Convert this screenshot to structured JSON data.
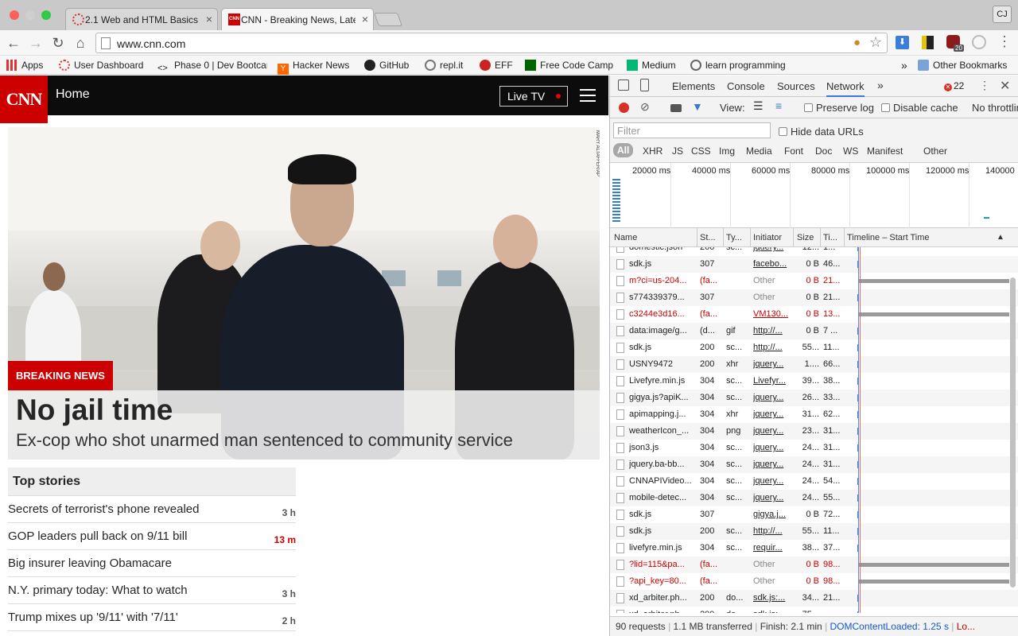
{
  "browser": {
    "tabs": [
      {
        "title": "2.1 Web and HTML Basics",
        "active": false
      },
      {
        "title": "CNN - Breaking News, Latest News and Videos",
        "active": true
      }
    ],
    "user_initials": "CJ",
    "url": "www.cnn.com",
    "extension_badge": "20",
    "bookmarks": [
      {
        "label": "Apps",
        "icon": "apps-grid-icon"
      },
      {
        "label": "User Dashboard",
        "icon": "dashboard-icon"
      },
      {
        "label": "Phase 0 | Dev Bootcamp",
        "icon": "code-icon"
      },
      {
        "label": "Hacker News",
        "icon": "hacker-news-icon"
      },
      {
        "label": "GitHub",
        "icon": "github-icon"
      },
      {
        "label": "repl.it",
        "icon": "replit-icon"
      },
      {
        "label": "EFF",
        "icon": "eff-icon"
      },
      {
        "label": "Free Code Camp",
        "icon": "freecodecamp-icon"
      },
      {
        "label": "Medium",
        "icon": "medium-icon"
      },
      {
        "label": "learn programming",
        "icon": "learn-icon"
      }
    ],
    "bookmarks_overflow": "»",
    "other_bookmarks": "Other Bookmarks"
  },
  "cnn": {
    "logo": "CNN",
    "section": "Home",
    "live_tv": "Live TV",
    "photo_credit": "MARY ALTAFFER/AP",
    "breaking_label": "BREAKING NEWS",
    "headline": "No jail time",
    "subheadline": "Ex-cop who shot unarmed man sentenced to community service",
    "top_stories_title": "Top stories",
    "stories": [
      {
        "title": "Secrets of terrorist's phone revealed",
        "time": "3 h",
        "fresh": false
      },
      {
        "title": "GOP leaders pull back on 9/11 bill",
        "time": "13 m",
        "fresh": true
      },
      {
        "title": "Big insurer leaving Obamacare",
        "time": "",
        "fresh": false
      },
      {
        "title": "N.Y. primary today: What to watch",
        "time": "3 h",
        "fresh": false
      },
      {
        "title": "Trump mixes up '9/11' with '7/11'",
        "time": "2 h",
        "fresh": false
      }
    ]
  },
  "devtools": {
    "tabs": [
      "Elements",
      "Console",
      "Sources",
      "Network"
    ],
    "active_tab": "Network",
    "more": "»",
    "error_count": "22",
    "view_label": "View:",
    "preserve_log": "Preserve log",
    "disable_cache": "Disable cache",
    "throttle": "No throttling",
    "filter_placeholder": "Filter",
    "hide_data_urls": "Hide data URLs",
    "filter_types": [
      "All",
      "XHR",
      "JS",
      "CSS",
      "Img",
      "Media",
      "Font",
      "Doc",
      "WS",
      "Manifest",
      "Other"
    ],
    "overview_ticks": [
      "20000 ms",
      "40000 ms",
      "60000 ms",
      "80000 ms",
      "100000 ms",
      "120000 ms",
      "140000"
    ],
    "columns": [
      "Name",
      "St...",
      "Ty...",
      "Initiator",
      "Size",
      "Ti...",
      "Timeline – Start Time"
    ],
    "rows": [
      {
        "name": "domestic.json",
        "status": "200",
        "type": "sc...",
        "initiator": "jquery...",
        "size": "12...",
        "time": "1...",
        "error": false,
        "bar": "short"
      },
      {
        "name": "sdk.js",
        "status": "307",
        "type": "",
        "initiator": "facebo...",
        "size": "0 B",
        "time": "46...",
        "error": false,
        "bar": "short"
      },
      {
        "name": "m?ci=us-204...",
        "status": "(fa...",
        "type": "",
        "initiator": "Other",
        "size": "0 B",
        "time": "21...",
        "error": true,
        "bar": "long"
      },
      {
        "name": "s774339379...",
        "status": "307",
        "type": "",
        "initiator": "Other",
        "size": "0 B",
        "time": "21...",
        "error": false,
        "bar": "short"
      },
      {
        "name": "c3244e3d16...",
        "status": "(fa...",
        "type": "",
        "initiator": "VM130...",
        "size": "0 B",
        "time": "13...",
        "error": true,
        "bar": "long"
      },
      {
        "name": "data:image/g...",
        "status": "(d...",
        "type": "gif",
        "initiator": "http://...",
        "size": "0 B",
        "time": "7 ...",
        "error": false,
        "bar": "short"
      },
      {
        "name": "sdk.js",
        "status": "200",
        "type": "sc...",
        "initiator": "http://...",
        "size": "55...",
        "time": "11...",
        "error": false,
        "bar": "short"
      },
      {
        "name": "USNY9472",
        "status": "200",
        "type": "xhr",
        "initiator": "jquery...",
        "size": "1....",
        "time": "66...",
        "error": false,
        "bar": "short"
      },
      {
        "name": "Livefyre.min.js",
        "status": "304",
        "type": "sc...",
        "initiator": "Livefyr...",
        "size": "39...",
        "time": "38...",
        "error": false,
        "bar": "short"
      },
      {
        "name": "gigya.js?apiK...",
        "status": "304",
        "type": "sc...",
        "initiator": "jquery...",
        "size": "26...",
        "time": "33...",
        "error": false,
        "bar": "short"
      },
      {
        "name": "apimapping.j...",
        "status": "304",
        "type": "xhr",
        "initiator": "jquery...",
        "size": "31...",
        "time": "62...",
        "error": false,
        "bar": "short"
      },
      {
        "name": "weatherIcon_...",
        "status": "304",
        "type": "png",
        "initiator": "jquery...",
        "size": "23...",
        "time": "31...",
        "error": false,
        "bar": "short"
      },
      {
        "name": "json3.js",
        "status": "304",
        "type": "sc...",
        "initiator": "jquery...",
        "size": "24...",
        "time": "31...",
        "error": false,
        "bar": "short"
      },
      {
        "name": "jquery.ba-bb...",
        "status": "304",
        "type": "sc...",
        "initiator": "jquery...",
        "size": "24...",
        "time": "31...",
        "error": false,
        "bar": "short"
      },
      {
        "name": "CNNAPIVideo...",
        "status": "304",
        "type": "sc...",
        "initiator": "jquery...",
        "size": "24...",
        "time": "54...",
        "error": false,
        "bar": "short"
      },
      {
        "name": "mobile-detec...",
        "status": "304",
        "type": "sc...",
        "initiator": "jquery...",
        "size": "24...",
        "time": "55...",
        "error": false,
        "bar": "short"
      },
      {
        "name": "sdk.js",
        "status": "307",
        "type": "",
        "initiator": "gigya.j...",
        "size": "0 B",
        "time": "72...",
        "error": false,
        "bar": "short"
      },
      {
        "name": "sdk.js",
        "status": "200",
        "type": "sc...",
        "initiator": "http://...",
        "size": "55...",
        "time": "11...",
        "error": false,
        "bar": "short"
      },
      {
        "name": "livefyre.min.js",
        "status": "304",
        "type": "sc...",
        "initiator": "requir...",
        "size": "38...",
        "time": "37...",
        "error": false,
        "bar": "short"
      },
      {
        "name": "?lid=115&pa...",
        "status": "(fa...",
        "type": "",
        "initiator": "Other",
        "size": "0 B",
        "time": "98...",
        "error": true,
        "bar": "long"
      },
      {
        "name": "?api_key=80...",
        "status": "(fa...",
        "type": "",
        "initiator": "Other",
        "size": "0 B",
        "time": "98...",
        "error": true,
        "bar": "long"
      },
      {
        "name": "xd_arbiter.ph...",
        "status": "200",
        "type": "do...",
        "initiator": "sdk.js:...",
        "size": "34...",
        "time": "21...",
        "error": false,
        "bar": "short"
      },
      {
        "name": "xd_arbiter.ph...",
        "status": "200",
        "type": "do...",
        "initiator": "sdk.js:...",
        "size": "75...",
        "time": "...",
        "error": false,
        "bar": "short"
      }
    ],
    "summary": {
      "requests": "90 requests",
      "transferred": "1.1 MB transferred",
      "finish": "Finish: 2.1 min",
      "dcl": "DOMContentLoaded: 1.25 s",
      "load": "Lo..."
    },
    "colors": {
      "accent": "#3879d9",
      "error": "#c80000",
      "record": "#d93025",
      "cnn_red": "#cc0000"
    }
  }
}
